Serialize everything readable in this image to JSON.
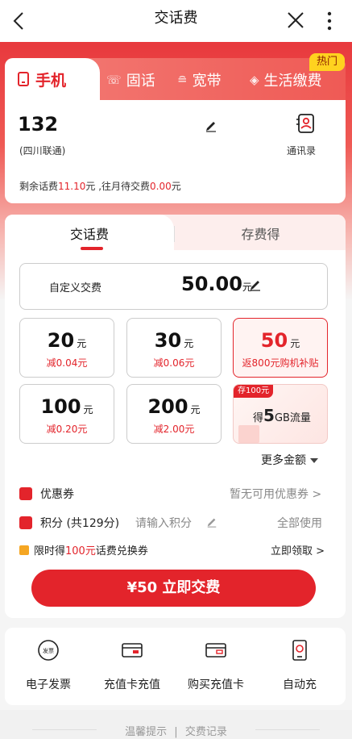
{
  "header": {
    "title": "交话费"
  },
  "top_tabs": [
    {
      "label": "手机"
    },
    {
      "label": "固话"
    },
    {
      "label": "宽带"
    },
    {
      "label": "生活缴费"
    }
  ],
  "hot_badge": "热门",
  "account": {
    "phone": "132",
    "carrier": "(四川联通)",
    "contacts_label": "通讯录",
    "balance_prefix": "剩余话费",
    "balance_amount": "11.10",
    "balance_mid": "元 ,往月待交费",
    "pending_amount": "0.00",
    "balance_suffix": "元"
  },
  "sub_tabs": [
    {
      "label": "交话费"
    },
    {
      "label": "存费得"
    }
  ],
  "custom_amount": {
    "label": "自定义交费",
    "value": "50.00",
    "unit": "元"
  },
  "amounts": [
    {
      "value": "20",
      "unit": "元",
      "note": "减0.04元"
    },
    {
      "value": "30",
      "unit": "元",
      "note": "减0.06元"
    },
    {
      "value": "50",
      "unit": "元",
      "note": "返800元购机补贴"
    },
    {
      "value": "100",
      "unit": "元",
      "note": "减0.20元"
    },
    {
      "value": "200",
      "unit": "元",
      "note": "减2.00元"
    }
  ],
  "gift_card": {
    "tag": "存100元",
    "prefix": "得",
    "amount": "5",
    "suffix": "GB流量"
  },
  "more_amounts": "更多金额",
  "coupon": {
    "label": "优惠券",
    "status": "暂无可用优惠券 >"
  },
  "points": {
    "label": "积分 (共129分)",
    "placeholder": "请输入积分",
    "use_all": "全部使用"
  },
  "promo": {
    "prefix": "限时得",
    "amount": "100元",
    "suffix": "话费兑换券",
    "claim": "立即领取 >"
  },
  "pay_button": "¥50 立即交费",
  "services": [
    {
      "label": "电子发票",
      "icon": "invoice-icon"
    },
    {
      "label": "充值卡充值",
      "icon": "recharge-card-icon"
    },
    {
      "label": "购买充值卡",
      "icon": "buy-card-icon"
    },
    {
      "label": "自动充",
      "icon": "auto-recharge-icon"
    }
  ],
  "footer": {
    "tips": "温馨提示",
    "sep": "|",
    "records": "交费记录"
  },
  "colors": {
    "accent": "#e3242b",
    "hot": "#ffd21f"
  }
}
